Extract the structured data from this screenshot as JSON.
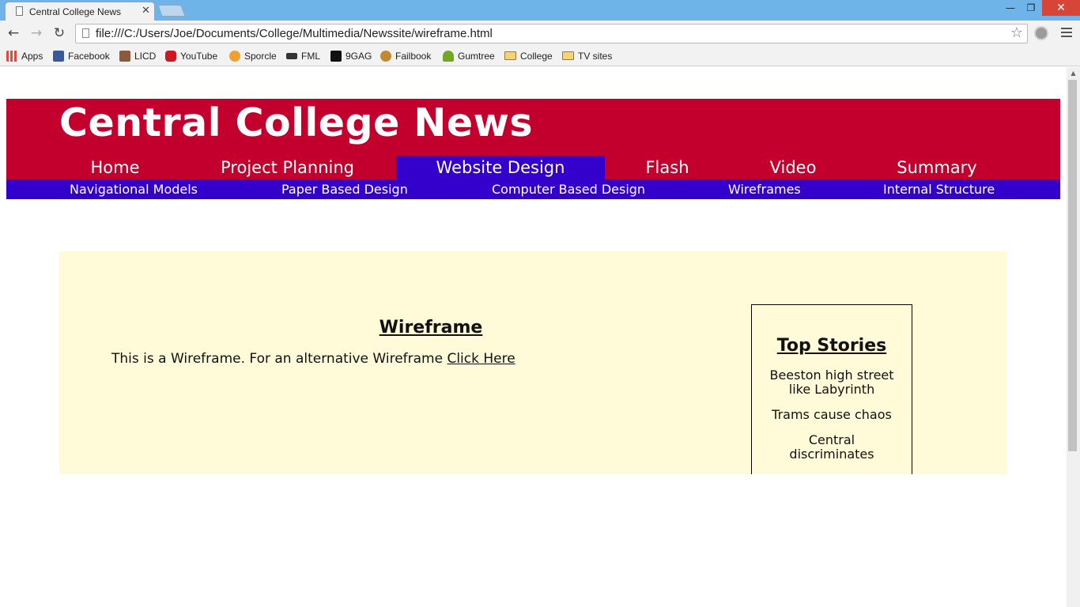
{
  "browser": {
    "tab_title": "Central College News",
    "tab_close": "✕",
    "url": "file:///C:/Users/Joe/Documents/College/Multimedia/Newssite/wireframe.html",
    "bookmarks": [
      {
        "label": "Apps",
        "color": "#e04a3c"
      },
      {
        "label": "Facebook",
        "color": "#3b5998"
      },
      {
        "label": "LICD",
        "color": "#8a5a3c"
      },
      {
        "label": "YouTube",
        "color": "#cc181e"
      },
      {
        "label": "Sporcle",
        "color": "#f0a030"
      },
      {
        "label": "FML",
        "color": "#333333"
      },
      {
        "label": "9GAG",
        "color": "#111111"
      },
      {
        "label": "Failbook",
        "color": "#c28a2c"
      },
      {
        "label": "Gumtree",
        "color": "#72a824"
      },
      {
        "label": "College",
        "color": "#f4d27a"
      },
      {
        "label": "TV sites",
        "color": "#f4d27a"
      }
    ]
  },
  "site": {
    "title": "Central College News",
    "nav": [
      "Home",
      "Project Planning",
      "Website Design",
      "Flash",
      "Video",
      "Summary"
    ],
    "active_nav": "Website Design",
    "subnav": [
      "Navigational Models",
      "Paper Based Design",
      "Computer Based Design",
      "Wireframes",
      "Internal Structure"
    ]
  },
  "content": {
    "heading": "Wireframe",
    "intro_text": "This is a Wireframe. For an alternative Wireframe ",
    "intro_link": "Click Here"
  },
  "top_stories": {
    "title": "Top Stories",
    "stories": [
      "Beeston high street like Labyrinth",
      "Trams cause chaos",
      "Central discriminates"
    ]
  },
  "colors": {
    "banner": "#c3002d",
    "nav_active": "#3300cc",
    "content_bg": "#fffad7"
  }
}
